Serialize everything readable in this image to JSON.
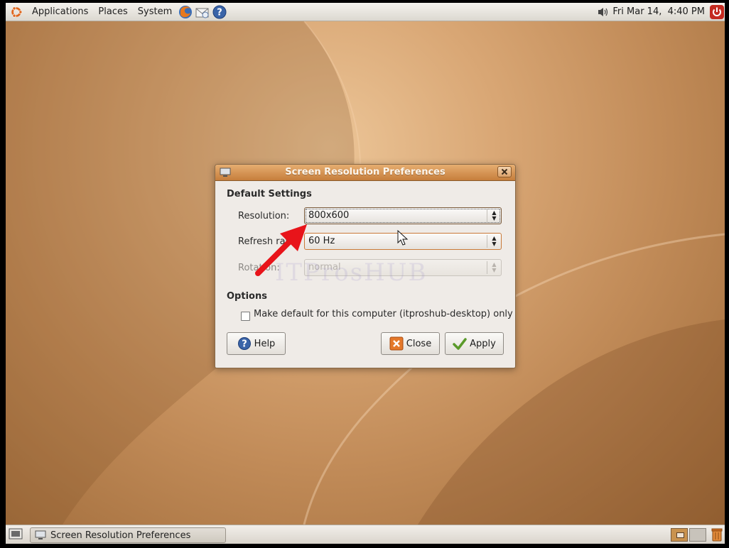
{
  "top_panel": {
    "menus": [
      "Applications",
      "Places",
      "System"
    ],
    "clock": "Fri Mar 14,  4:40 PM"
  },
  "dialog": {
    "title": "Screen Resolution Preferences",
    "sections": {
      "default_settings": "Default Settings",
      "options": "Options"
    },
    "fields": {
      "resolution": {
        "label": "Resolution:",
        "value": "800x600"
      },
      "refresh_rate": {
        "label": "Refresh rate:",
        "value": "60 Hz"
      },
      "rotation": {
        "label": "Rotation:",
        "value": "normal",
        "disabled": true
      }
    },
    "checkbox": {
      "label": "Make default for this computer (itproshub-desktop) only",
      "checked": false
    },
    "buttons": {
      "help": "Help",
      "close": "Close",
      "apply": "Apply"
    },
    "watermark": "ITProsHUB"
  },
  "taskbar": {
    "window_button": "Screen Resolution Preferences"
  },
  "colors": {
    "titlebar_accent": "#c67e3c",
    "annotation_arrow": "#e8141a"
  }
}
